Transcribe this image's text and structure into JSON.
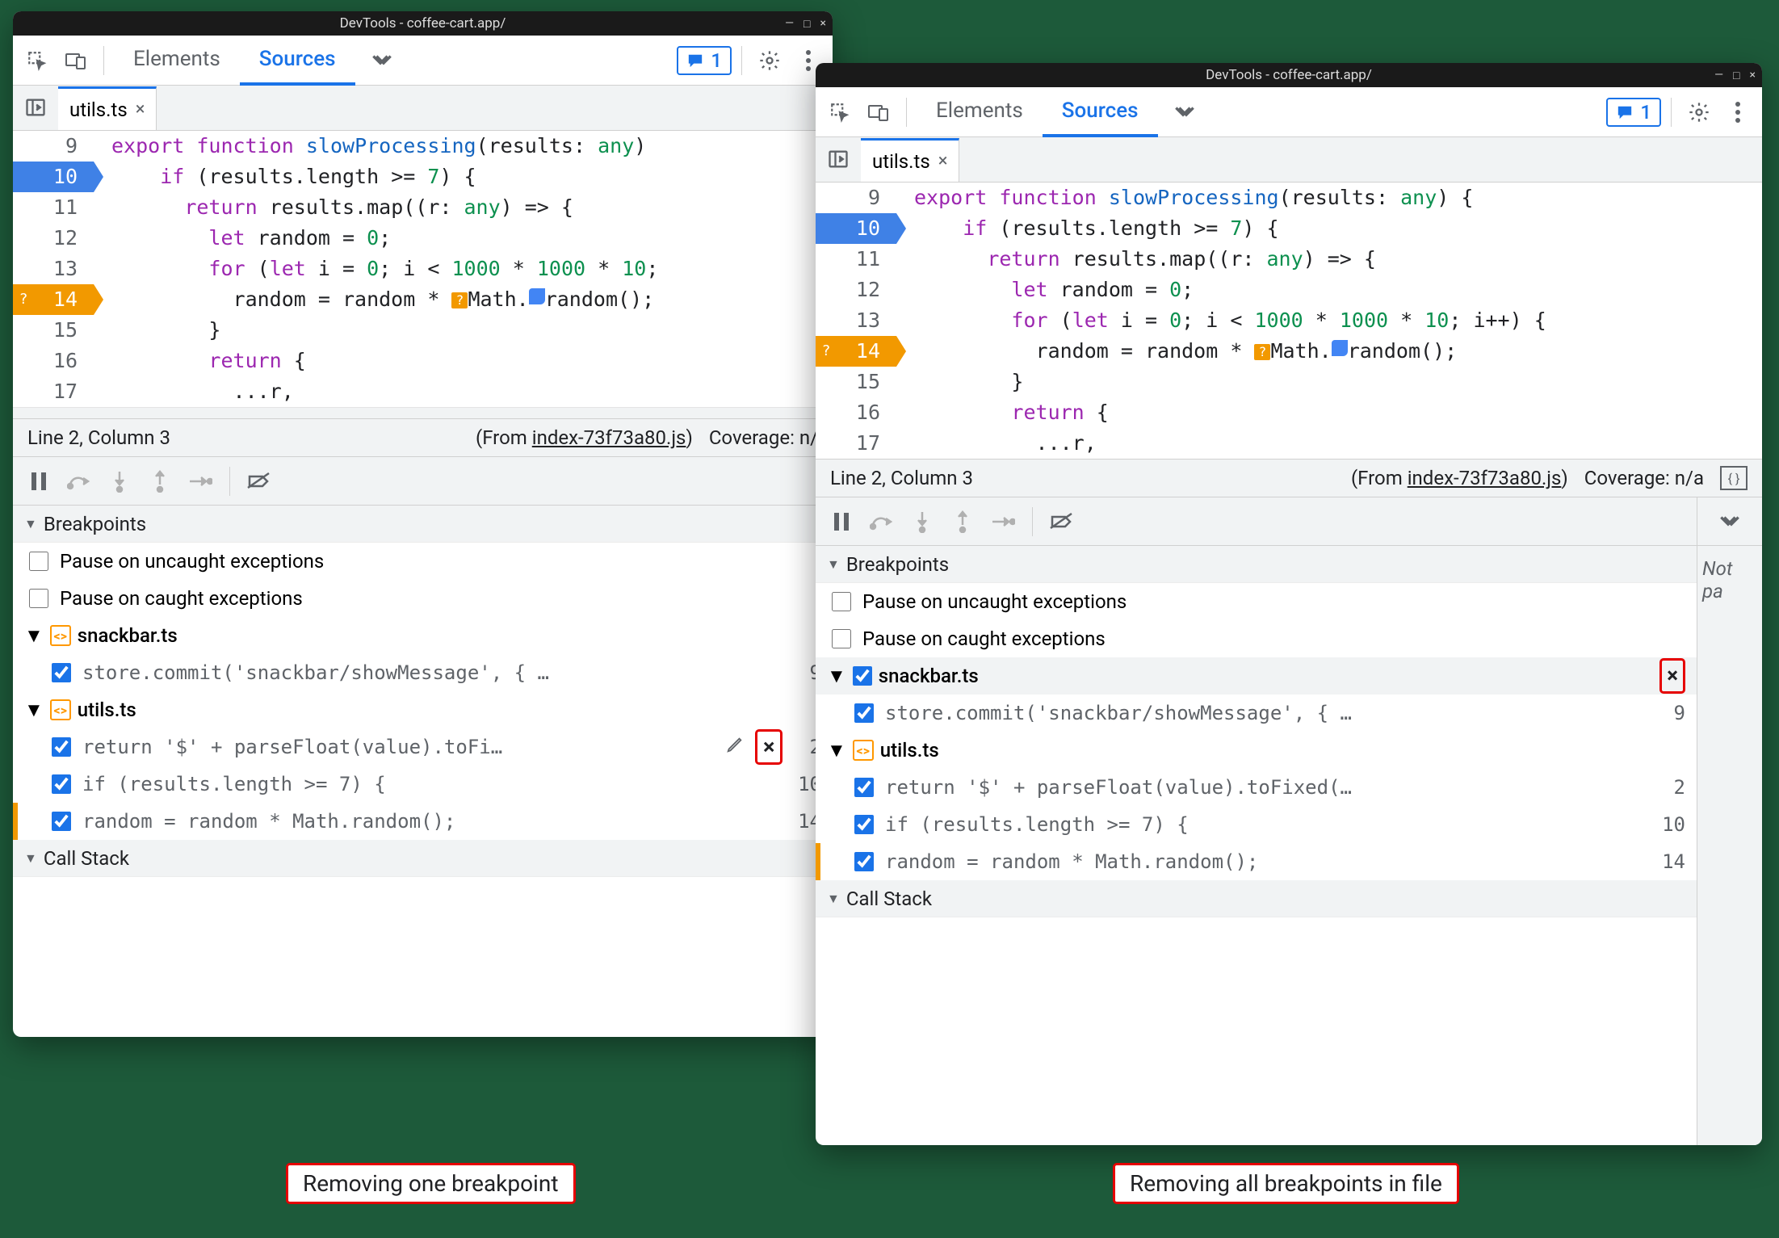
{
  "title": "DevTools - coffee-cart.app/",
  "tabs": {
    "elements": "Elements",
    "sources": "Sources"
  },
  "msg_count": "1",
  "file_tab": "utils.ts",
  "code": {
    "l9": {
      "n": "9",
      "t1": "export",
      "t2": "function",
      "fn": "slowProcessing",
      "t3": "(results:",
      "typ": "any",
      "t4": ")",
      "brace": "{"
    },
    "l9b": {
      "tail": "{"
    },
    "l10": {
      "n": "10",
      "txt": "    if (results.length >= 7) {"
    },
    "l10tok": {
      "kw": "if",
      "rest": " (results.length >= ",
      "num": "7",
      "end": ") {"
    },
    "l11": {
      "n": "11",
      "kw": "return",
      "txt": " results.map((r: ",
      "typ": "any",
      "end": ") => {"
    },
    "l12": {
      "n": "12",
      "kw": "let",
      "txt": " random = ",
      "num": "0",
      "end": ";"
    },
    "l13": {
      "n": "13",
      "kw": "for",
      "txt": " (",
      "kw2": "let",
      "txt2": " i = ",
      "n0": "0",
      "txt3": "; i < ",
      "n1": "1000",
      "op": " * ",
      "n2": "1000",
      "op2": " * ",
      "n3": "10",
      "tail_short": ";",
      "tail_long": "; i++) {"
    },
    "l14": {
      "n": "14",
      "txt": "          random = random * ",
      "math": "Math.",
      "rand": "random",
      "end": "();"
    },
    "l15": {
      "n": "15",
      "txt": "        }"
    },
    "l16": {
      "n": "16",
      "kw": "return",
      "end": " {"
    },
    "l17": {
      "n": "17",
      "txt": "          ...r,"
    }
  },
  "status": {
    "pos": "Line 2, Column 3",
    "from": "(From ",
    "link": "index-73f73a80.js",
    "close": ")",
    "cov_short": "Coverage: n/",
    "cov_long": "Coverage: n/a"
  },
  "breakpoints_title": "Breakpoints",
  "callstack_title": "Call Stack",
  "pause_uncaught": "Pause on uncaught exceptions",
  "pause_caught": "Pause on caught exceptions",
  "groups": {
    "snackbar": {
      "name": "snackbar.ts",
      "item1": "store.commit('snackbar/showMessage', { …",
      "line1": "9"
    },
    "utils": {
      "name": "utils.ts",
      "i1_short": "return '$' + parseFloat(value).toFi…",
      "i1_long": "return '$' + parseFloat(value).toFixed(…",
      "l1": "2",
      "i2": "if (results.length >= 7) {",
      "l2": "10",
      "i3": "random = random * Math.random();",
      "l3": "14"
    }
  },
  "captions": {
    "left": "Removing one breakpoint",
    "right": "Removing all breakpoints in file"
  },
  "notpa": "Not pa"
}
